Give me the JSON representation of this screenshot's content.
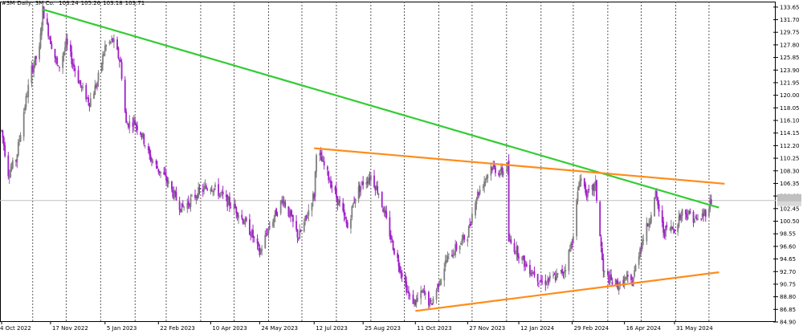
{
  "header": {
    "symbol": "#3M",
    "timeframe": "Daily:",
    "name": "3M Co.",
    "ohlc": [
      "103.24",
      "105.26",
      "103.18",
      "103.71"
    ]
  },
  "colors": {
    "background": "#ffffff",
    "bull_candle": "#7f7f7f",
    "bear_candle": "#a020c8",
    "downtrend_line": "#33cc33",
    "triangle_lines": "#ff8c1a",
    "grid": "#333333",
    "price_line": "#c0c0c0"
  },
  "chart_data": {
    "type": "candlestick",
    "instrument": "#3M",
    "timeframe": "Daily",
    "x_tick_labels": [
      "4 Oct 2022",
      "17 Nov 2022",
      "5 Jan 2023",
      "22 Feb 2023",
      "10 Apr 2023",
      "24 May 2023",
      "12 Jul 2023",
      "25 Aug 2023",
      "11 Oct 2023",
      "27 Nov 2023",
      "12 Jan 2024",
      "29 Feb 2024",
      "16 Apr 2024",
      "31 May 2024"
    ],
    "y_tick_labels": [
      "133.65",
      "131.70",
      "129.75",
      "127.80",
      "125.85",
      "123.90",
      "121.95",
      "120.00",
      "118.05",
      "116.10",
      "114.15",
      "112.20",
      "110.25",
      "108.30",
      "106.35",
      "104.40",
      "102.45",
      "100.50",
      "98.55",
      "96.60",
      "94.65",
      "92.70",
      "90.75",
      "88.80",
      "86.85",
      "84.90"
    ],
    "ylim": [
      84.9,
      134.5
    ],
    "grid": "vertical dotted",
    "current_price": "103.71",
    "price_path": [
      [
        "4 Oct 2022",
        114.5
      ],
      [
        "10 Oct 2022",
        108.0
      ],
      [
        "17 Oct 2022",
        110.0
      ],
      [
        "24 Oct 2022",
        117.5
      ],
      [
        "31 Oct 2022",
        124.0
      ],
      [
        "7 Nov 2022",
        127.0
      ],
      [
        "10 Nov 2022",
        133.3
      ],
      [
        "14 Nov 2022",
        130.5
      ],
      [
        "17 Nov 2022",
        128.5
      ],
      [
        "24 Nov 2022",
        124.0
      ],
      [
        "1 Dec 2022",
        128.0
      ],
      [
        "8 Dec 2022",
        124.5
      ],
      [
        "15 Dec 2022",
        121.0
      ],
      [
        "22 Dec 2022",
        119.0
      ],
      [
        "29 Dec 2022",
        122.0
      ],
      [
        "5 Jan 2023",
        127.5
      ],
      [
        "12 Jan 2023",
        128.5
      ],
      [
        "19 Jan 2023",
        125.0
      ],
      [
        "24 Jan 2023",
        115.5
      ],
      [
        "31 Jan 2023",
        116.0
      ],
      [
        "7 Feb 2023",
        114.0
      ],
      [
        "14 Feb 2023",
        110.5
      ],
      [
        "22 Feb 2023",
        108.5
      ],
      [
        "1 Mar 2023",
        107.0
      ],
      [
        "8 Mar 2023",
        104.5
      ],
      [
        "15 Mar 2023",
        102.5
      ],
      [
        "22 Mar 2023",
        103.5
      ],
      [
        "30 Mar 2023",
        105.0
      ],
      [
        "10 Apr 2023",
        106.0
      ],
      [
        "17 Apr 2023",
        105.0
      ],
      [
        "25 Apr 2023",
        103.5
      ],
      [
        "2 May 2023",
        102.5
      ],
      [
        "10 May 2023",
        100.5
      ],
      [
        "17 May 2023",
        98.5
      ],
      [
        "24 May 2023",
        95.5
      ],
      [
        "31 May 2023",
        99.0
      ],
      [
        "7 Jun 2023",
        101.5
      ],
      [
        "14 Jun 2023",
        104.0
      ],
      [
        "21 Jun 2023",
        101.0
      ],
      [
        "28 Jun 2023",
        98.0
      ],
      [
        "5 Jul 2023",
        101.0
      ],
      [
        "10 Jul 2023",
        104.0
      ],
      [
        "12 Jul 2023",
        104.5
      ],
      [
        "14 Jul 2023",
        111.5
      ],
      [
        "21 Jul 2023",
        109.0
      ],
      [
        "28 Jul 2023",
        106.0
      ],
      [
        "4 Aug 2023",
        103.0
      ],
      [
        "11 Aug 2023",
        99.5
      ],
      [
        "18 Aug 2023",
        104.5
      ],
      [
        "25 Aug 2023",
        106.5
      ],
      [
        "1 Sep 2023",
        107.5
      ],
      [
        "8 Sep 2023",
        105.0
      ],
      [
        "15 Sep 2023",
        100.5
      ],
      [
        "22 Sep 2023",
        96.0
      ],
      [
        "29 Sep 2023",
        92.5
      ],
      [
        "6 Oct 2023",
        88.5
      ],
      [
        "11 Oct 2023",
        88.0
      ],
      [
        "18 Oct 2023",
        89.5
      ],
      [
        "25 Oct 2023",
        87.5
      ],
      [
        "1 Nov 2023",
        91.0
      ],
      [
        "8 Nov 2023",
        94.5
      ],
      [
        "15 Nov 2023",
        96.0
      ],
      [
        "27 Nov 2023",
        98.5
      ],
      [
        "4 Dec 2023",
        104.0
      ],
      [
        "11 Dec 2023",
        106.5
      ],
      [
        "18 Dec 2023",
        109.0
      ],
      [
        "27 Dec 2023",
        108.0
      ],
      [
        "2 Jan 2024",
        109.0
      ],
      [
        "3 Jan 2024",
        97.5
      ],
      [
        "12 Jan 2024",
        95.5
      ],
      [
        "19 Jan 2024",
        93.5
      ],
      [
        "26 Jan 2024",
        92.5
      ],
      [
        "2 Feb 2024",
        91.0
      ],
      [
        "9 Feb 2024",
        91.5
      ],
      [
        "16 Feb 2024",
        92.0
      ],
      [
        "22 Feb 2024",
        93.0
      ],
      [
        "29 Feb 2024",
        97.5
      ],
      [
        "7 Mar 2024",
        107.5
      ],
      [
        "14 Mar 2024",
        104.5
      ],
      [
        "21 Mar 2024",
        106.0
      ],
      [
        "28 Mar 2024",
        92.5
      ],
      [
        "5 Apr 2024",
        91.0
      ],
      [
        "12 Apr 2024",
        90.5
      ],
      [
        "16 Apr 2024",
        91.5
      ],
      [
        "23 Apr 2024",
        91.0
      ],
      [
        "30 Apr 2024",
        96.5
      ],
      [
        "7 May 2024",
        100.0
      ],
      [
        "14 May 2024",
        104.5
      ],
      [
        "21 May 2024",
        99.0
      ],
      [
        "31 May 2024",
        99.5
      ],
      [
        "7 Jun 2024",
        102.0
      ],
      [
        "14 Jun 2024",
        101.5
      ],
      [
        "21 Jun 2024",
        100.5
      ],
      [
        "28 Jun 2024",
        102.0
      ],
      [
        "3 Jul 2024",
        103.7
      ]
    ],
    "trendlines": [
      {
        "style": "green",
        "from": [
          "10 Nov 2022",
          133.3
        ],
        "to": [
          "10 Jul 2024",
          102.6
        ]
      },
      {
        "style": "orange",
        "from": [
          "12 Jul 2023",
          111.8
        ],
        "to": [
          "15 Jul 2024",
          106.3
        ]
      },
      {
        "style": "orange",
        "from": [
          "11 Oct 2023",
          86.6
        ],
        "to": [
          "10 Jul 2024",
          92.6
        ]
      }
    ]
  }
}
